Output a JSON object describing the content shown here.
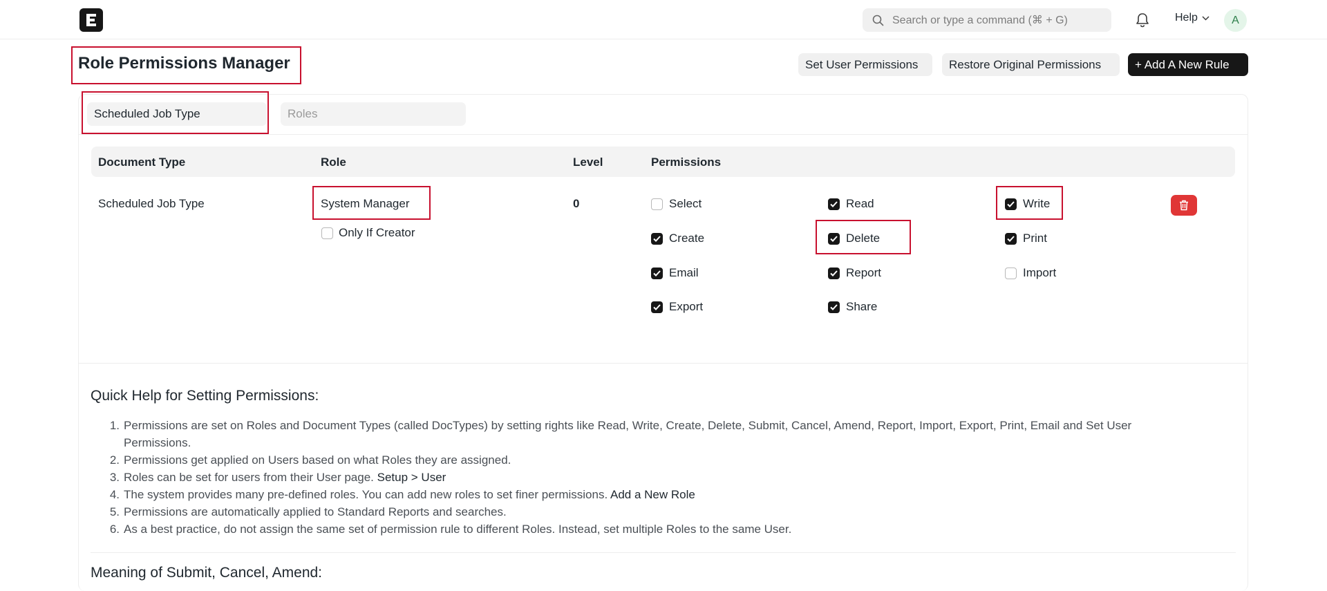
{
  "navbar": {
    "logo_letter": "E",
    "search_placeholder": "Search or type a command (⌘ + G)",
    "help_label": "Help",
    "avatar_initial": "A"
  },
  "header": {
    "title": "Role Permissions Manager",
    "set_user_permissions": "Set User Permissions",
    "restore_permissions": "Restore Original Permissions",
    "add_rule": "+ Add A New Rule"
  },
  "filters": {
    "doctype_value": "Scheduled Job Type",
    "roles_placeholder": "Roles"
  },
  "table": {
    "headers": [
      "Document Type",
      "Role",
      "Level",
      "Permissions"
    ],
    "row": {
      "document_type": "Scheduled Job Type",
      "role": "System Manager",
      "only_if_creator_label": "Only If Creator",
      "only_if_creator": false,
      "level": "0",
      "permissions": [
        {
          "label": "Select",
          "checked": false
        },
        {
          "label": "Read",
          "checked": true
        },
        {
          "label": "Write",
          "checked": true
        },
        {
          "label": "Create",
          "checked": true
        },
        {
          "label": "Delete",
          "checked": true
        },
        {
          "label": "Print",
          "checked": true
        },
        {
          "label": "Email",
          "checked": true
        },
        {
          "label": "Report",
          "checked": true
        },
        {
          "label": "Import",
          "checked": false
        },
        {
          "label": "Export",
          "checked": true
        },
        {
          "label": "Share",
          "checked": true
        }
      ]
    }
  },
  "quick_help": {
    "title": "Quick Help for Setting Permissions:",
    "items": [
      {
        "text": "Permissions are set on Roles and Document Types (called DocTypes) by setting rights like Read, Write, Create, Delete, Submit, Cancel, Amend, Report, Import, Export, Print, Email and Set User Permissions.",
        "link": ""
      },
      {
        "text": "Permissions get applied on Users based on what Roles they are assigned.",
        "link": ""
      },
      {
        "text": "Roles can be set for users from their User page.",
        "link": "Setup > User"
      },
      {
        "text": "The system provides many pre-defined roles. You can add new roles to set finer permissions.",
        "link": "Add a New Role"
      },
      {
        "text": "Permissions are automatically applied to Standard Reports and searches.",
        "link": ""
      },
      {
        "text": "As a best practice, do not assign the same set of permission rule to different Roles. Instead, set multiple Roles to the same User.",
        "link": ""
      }
    ]
  },
  "meaning": {
    "title": "Meaning of Submit, Cancel, Amend:"
  },
  "colors": {
    "highlight": "#c8102e",
    "danger": "#e03636",
    "primary": "#171717"
  }
}
